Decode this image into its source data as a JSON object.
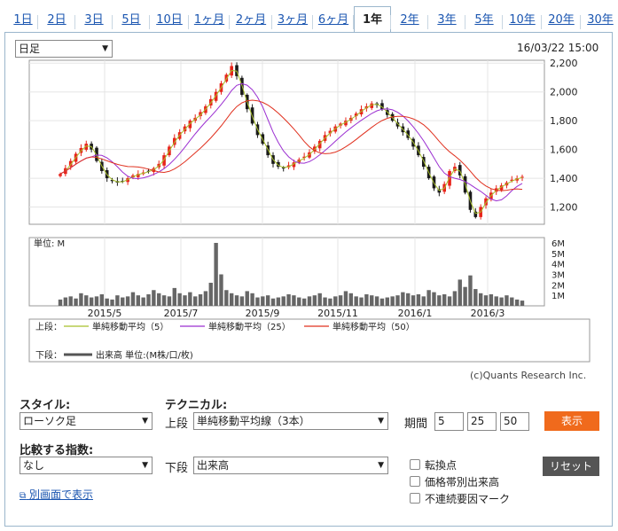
{
  "tabs": [
    "1日",
    "2日",
    "3日",
    "5日",
    "10日",
    "1ヶ月",
    "2ヶ月",
    "3ヶ月",
    "6ヶ月",
    "1年",
    "2年",
    "3年",
    "5年",
    "10年",
    "20年",
    "30年"
  ],
  "active_tab": "1年",
  "period_select": "日足",
  "timestamp": "16/03/22 15:00",
  "copyright": "(c)Quants Research Inc.",
  "legend": {
    "upper_label": "上段：",
    "lower_label": "下段：",
    "items": [
      {
        "name": "単純移動平均（5）",
        "color": "#a8c02a"
      },
      {
        "name": "単純移動平均（25）",
        "color": "#9b2fd1"
      },
      {
        "name": "単純移動平均（50）",
        "color": "#e0301e"
      }
    ],
    "volume_item": {
      "name": "出来高 単位:(M株/口/枚)",
      "color": "#555555"
    }
  },
  "controls": {
    "style_label": "スタイル:",
    "style_value": "ローソク足",
    "technical_label": "テクニカル:",
    "upper_prefix": "上段",
    "upper_value": "単純移動平均線（3本）",
    "period_label": "期間",
    "period_values": [
      "5",
      "25",
      "50"
    ],
    "show_button": "表示",
    "compare_label": "比較する指数:",
    "compare_value": "なし",
    "lower_prefix": "下段",
    "lower_value": "出来高",
    "reset_button": "リセット",
    "checkboxes": [
      "転換点",
      "価格帯別出来高",
      "不連続要因マーク"
    ],
    "popup_link": "別画面で表示"
  },
  "colors": {
    "up": "#e8231a",
    "down": "#1a1a1a",
    "volume": "#666666",
    "accent": "#f06a1c",
    "reset": "#555555"
  },
  "chart_data": [
    {
      "type": "candlestick",
      "title": "",
      "x_tick_labels": [
        "2015/5",
        "2015/7",
        "2015/9",
        "2015/11",
        "2016/1",
        "2016/3"
      ],
      "y_tick_labels": [
        "1,200",
        "1,400",
        "1,600",
        "1,800",
        "2,000",
        "2,200"
      ],
      "ylim": [
        1080,
        2220
      ],
      "close_series": [
        1430,
        1470,
        1520,
        1570,
        1610,
        1640,
        1600,
        1520,
        1450,
        1400,
        1380,
        1370,
        1380,
        1400,
        1420,
        1430,
        1440,
        1450,
        1470,
        1500,
        1560,
        1620,
        1680,
        1720,
        1760,
        1800,
        1820,
        1860,
        1900,
        1950,
        2000,
        2060,
        2120,
        2180,
        2110,
        1980,
        1880,
        1780,
        1700,
        1640,
        1560,
        1500,
        1480,
        1470,
        1490,
        1510,
        1530,
        1550,
        1580,
        1620,
        1660,
        1700,
        1730,
        1760,
        1780,
        1800,
        1820,
        1850,
        1880,
        1900,
        1920,
        1910,
        1880,
        1840,
        1800,
        1760,
        1720,
        1680,
        1620,
        1560,
        1480,
        1400,
        1330,
        1300,
        1360,
        1450,
        1480,
        1420,
        1300,
        1180,
        1130,
        1200,
        1260,
        1300,
        1330,
        1350,
        1370,
        1390,
        1400,
        1410
      ],
      "ma_colors": {
        "ma5": "#a8c02a",
        "ma25": "#9b2fd1",
        "ma50": "#e0301e"
      }
    },
    {
      "type": "bar",
      "title": "",
      "ylabel": "単位: M",
      "y_tick_labels": [
        "1M",
        "2M",
        "3M",
        "4M",
        "5M",
        "6M"
      ],
      "ylim": [
        0,
        6
      ],
      "values": [
        0.6,
        0.8,
        0.9,
        0.7,
        1.2,
        1.0,
        0.8,
        0.9,
        1.1,
        0.7,
        0.6,
        1.0,
        0.8,
        0.9,
        1.3,
        1.0,
        0.8,
        1.1,
        1.5,
        1.2,
        1.0,
        0.9,
        1.7,
        1.2,
        1.0,
        1.3,
        0.9,
        1.1,
        1.4,
        2.2,
        6.0,
        3.0,
        1.5,
        1.2,
        1.0,
        0.9,
        1.4,
        1.2,
        0.8,
        0.9,
        1.0,
        0.7,
        0.8,
        0.9,
        1.1,
        1.0,
        0.8,
        0.7,
        0.9,
        1.0,
        1.2,
        0.8,
        0.7,
        0.9,
        1.0,
        1.4,
        1.2,
        0.9,
        0.8,
        1.1,
        1.0,
        0.9,
        0.7,
        0.8,
        0.9,
        1.0,
        1.3,
        1.2,
        1.0,
        1.1,
        0.9,
        1.5,
        1.3,
        1.0,
        1.1,
        0.9,
        1.4,
        2.5,
        1.8,
        2.9,
        1.6,
        1.2,
        1.0,
        1.1,
        0.9,
        0.8,
        1.0,
        0.8,
        0.6,
        0.5
      ]
    }
  ]
}
